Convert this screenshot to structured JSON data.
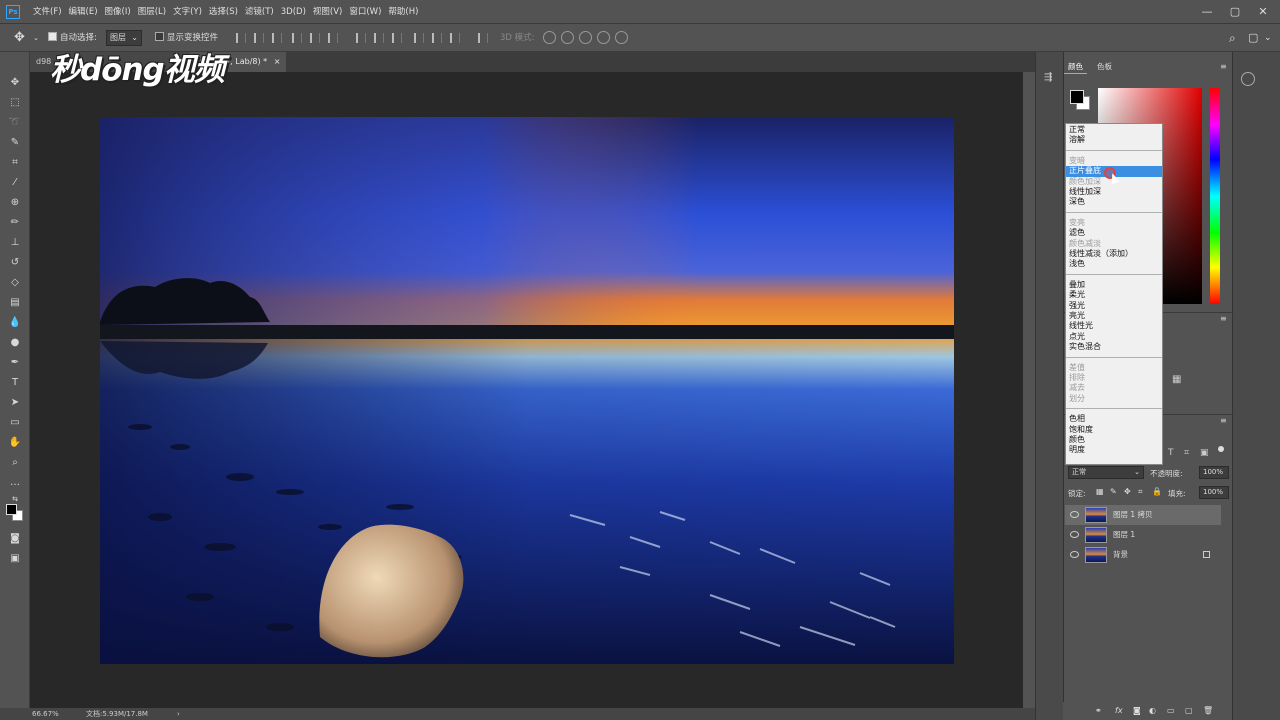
{
  "app": {
    "logo": "Ps"
  },
  "menu": [
    "文件(F)",
    "编辑(E)",
    "图像(I)",
    "图层(L)",
    "文字(Y)",
    "选择(S)",
    "滤镜(T)",
    "3D(D)",
    "视图(V)",
    "窗口(W)",
    "帮助(H)"
  ],
  "window_controls": [
    "—",
    "▢",
    "✕"
  ],
  "options": {
    "auto_select_label": "自动选择:",
    "auto_select_value": "图层",
    "show_transform_label": "显示变换控件",
    "mode_3d_label": "3D 模式:"
  },
  "tabs": {
    "inactive": "d98",
    "active": "层 1 拷贝, Lab/8) *",
    "close": "×"
  },
  "watermark": "秒dōng视频",
  "status": {
    "zoom": "66.67%",
    "doc": "文档:5.93M/17.8M",
    "arrow": "›"
  },
  "color_panel": {
    "tabs": [
      "颜色",
      "色板"
    ],
    "menu_icon": "≡"
  },
  "blend_menu": {
    "groups": [
      [
        {
          "label": "正常",
          "state": "normal"
        },
        {
          "label": "溶解",
          "state": "normal"
        }
      ],
      [
        {
          "label": "变暗",
          "state": "disabled"
        },
        {
          "label": "正片叠底",
          "state": "selected"
        },
        {
          "label": "颜色加深",
          "state": "disabled"
        },
        {
          "label": "线性加深",
          "state": "normal"
        },
        {
          "label": "深色",
          "state": "normal"
        }
      ],
      [
        {
          "label": "变亮",
          "state": "disabled"
        },
        {
          "label": "滤色",
          "state": "normal"
        },
        {
          "label": "颜色减淡",
          "state": "disabled"
        },
        {
          "label": "线性减淡（添加）",
          "state": "normal"
        },
        {
          "label": "浅色",
          "state": "normal"
        }
      ],
      [
        {
          "label": "叠加",
          "state": "normal"
        },
        {
          "label": "柔光",
          "state": "normal"
        },
        {
          "label": "强光",
          "state": "normal"
        },
        {
          "label": "亮光",
          "state": "normal"
        },
        {
          "label": "线性光",
          "state": "normal"
        },
        {
          "label": "点光",
          "state": "normal"
        },
        {
          "label": "实色混合",
          "state": "normal"
        }
      ],
      [
        {
          "label": "差值",
          "state": "disabled"
        },
        {
          "label": "排除",
          "state": "disabled"
        },
        {
          "label": "减去",
          "state": "disabled"
        },
        {
          "label": "划分",
          "state": "disabled"
        }
      ],
      [
        {
          "label": "色相",
          "state": "normal"
        },
        {
          "label": "饱和度",
          "state": "normal"
        },
        {
          "label": "颜色",
          "state": "normal"
        },
        {
          "label": "明度",
          "state": "normal"
        }
      ]
    ]
  },
  "layers_panel": {
    "blend_mode": "正常",
    "opacity_label": "不透明度:",
    "opacity_value": "100%",
    "lock_label": "锁定:",
    "fill_label": "填充:",
    "fill_value": "100%",
    "layers": [
      {
        "name": "图层 1 拷贝",
        "active": true,
        "locked": false
      },
      {
        "name": "图层 1",
        "active": false,
        "locked": false
      },
      {
        "name": "背景",
        "active": false,
        "locked": true
      }
    ],
    "bottom_icons": [
      "link-icon",
      "fx-icon",
      "mask-icon",
      "adjustment-icon",
      "group-icon",
      "new-layer-icon",
      "trash-icon"
    ],
    "bottom_fx": "fx"
  },
  "colors": {
    "accent": "#3b8fe3",
    "ps_blue": "#31a8ff"
  }
}
